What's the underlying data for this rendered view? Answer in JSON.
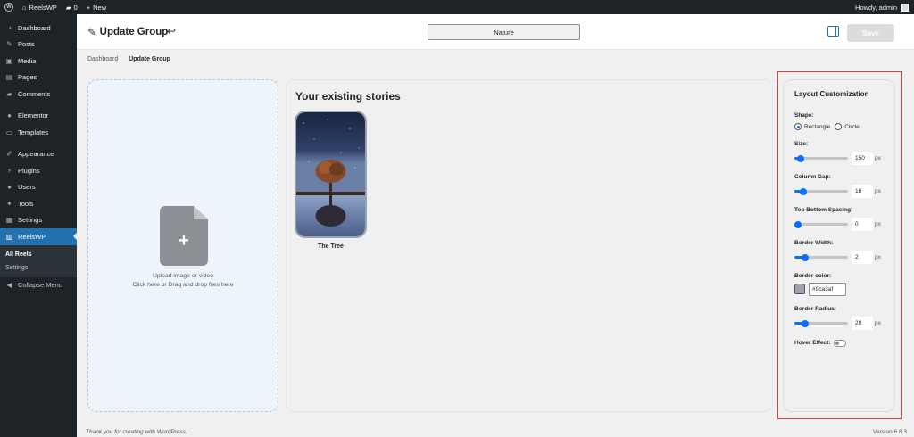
{
  "adminbar": {
    "site_name": "ReelsWP",
    "comments_count": "0",
    "new_label": "New",
    "howdy": "Howdy, admin"
  },
  "sidebar": {
    "items": [
      {
        "label": "Dashboard",
        "icon": "dashboard-icon"
      },
      {
        "label": "Posts",
        "icon": "pin-icon"
      },
      {
        "label": "Media",
        "icon": "media-icon"
      },
      {
        "label": "Pages",
        "icon": "page-icon"
      },
      {
        "label": "Comments",
        "icon": "comment-icon"
      },
      {
        "label": "Elementor",
        "icon": "elementor-icon"
      },
      {
        "label": "Templates",
        "icon": "folder-icon"
      },
      {
        "label": "Appearance",
        "icon": "brush-icon"
      },
      {
        "label": "Plugins",
        "icon": "plug-icon"
      },
      {
        "label": "Users",
        "icon": "user-icon"
      },
      {
        "label": "Tools",
        "icon": "wrench-icon"
      },
      {
        "label": "Settings",
        "icon": "settings-icon"
      },
      {
        "label": "ReelsWP",
        "icon": "reels-icon"
      }
    ],
    "submenu": [
      "All Reels",
      "Settings"
    ],
    "collapse": "Collapse Menu"
  },
  "header": {
    "title": "Update Group",
    "group_name": "Nature",
    "save_label": "Save"
  },
  "breadcrumb": {
    "home": "Dashboard",
    "current": "Update Group"
  },
  "upload": {
    "line1": "Upload image or video",
    "line2": "Click here or Drag and drop files here"
  },
  "stories": {
    "heading": "Your existing stories",
    "items": [
      {
        "title": "The Tree"
      }
    ]
  },
  "customization": {
    "title": "Layout Customization",
    "shape_label": "Shape:",
    "shape_options": [
      "Rectangle",
      "Circle"
    ],
    "shape_selected": "Rectangle",
    "size_label": "Size:",
    "size_value": "150",
    "size_fraction": 0.12,
    "column_gap_label": "Column Gap:",
    "column_gap_value": "16",
    "column_gap_fraction": 0.16,
    "top_bottom_label": "Top Bottom Spacing:",
    "top_bottom_value": "0",
    "top_bottom_fraction": 0.0,
    "border_width_label": "Border Width:",
    "border_width_value": "2",
    "border_width_fraction": 0.2,
    "border_color_label": "Border color:",
    "border_color_value": "#9ca3af",
    "border_radius_label": "Border Radius:",
    "border_radius_value": "20",
    "border_radius_fraction": 0.2,
    "hover_label": "Hover Effect:",
    "unit": "px"
  },
  "footer": {
    "thanks": "Thank you for creating with WordPress.",
    "version": "Version 6.8.3"
  },
  "colors": {
    "accent": "#2271b1",
    "slider": "#0d6efd",
    "highlight": "#e53935"
  }
}
